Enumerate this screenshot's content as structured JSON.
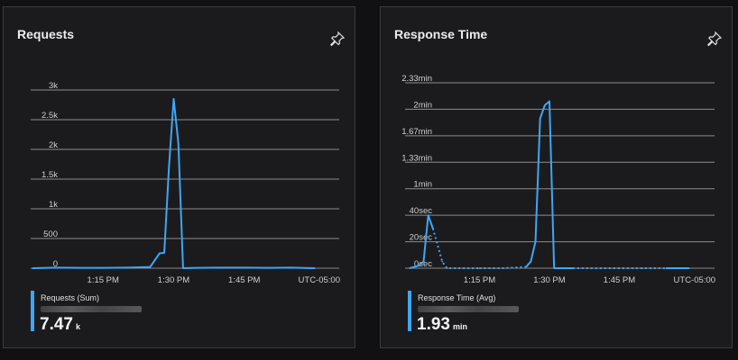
{
  "tiles": [
    {
      "title": "Requests",
      "pin_icon": "pin-icon",
      "y_ticks": [
        "0",
        "500",
        "1k",
        "1.5k",
        "2k",
        "2.5k",
        "3k"
      ],
      "x_ticks": [
        "1:15 PM",
        "1:30 PM",
        "1:45 PM"
      ],
      "timezone": "UTC-05:00",
      "legend": {
        "name": "Requests (Sum)",
        "value": "7.47",
        "unit": "k",
        "color": "#3ea6f5"
      }
    },
    {
      "title": "Response Time",
      "pin_icon": "pin-icon",
      "y_ticks": [
        "0sec",
        "20sec",
        "40sec",
        "1min",
        "1.33min",
        "1.67min",
        "2min",
        "2.33min"
      ],
      "x_ticks": [
        "1:15 PM",
        "1:30 PM",
        "1:45 PM"
      ],
      "timezone": "UTC-05:00",
      "legend": {
        "name": "Response Time (Avg)",
        "value": "1.93",
        "unit": "min",
        "color": "#3ea6f5"
      }
    }
  ],
  "chart_data": [
    {
      "type": "line",
      "title": "Requests",
      "ylabel": "",
      "ylim": [
        0,
        3000
      ],
      "series": [
        {
          "name": "Requests (Sum)",
          "points": [
            [
              "1:00 PM",
              0
            ],
            [
              "1:05 PM",
              10
            ],
            [
              "1:10 PM",
              5
            ],
            [
              "1:15 PM",
              5
            ],
            [
              "1:20 PM",
              10
            ],
            [
              "1:25 PM",
              20
            ],
            [
              "1:27 PM",
              250
            ],
            [
              "1:28 PM",
              260
            ],
            [
              "1:29 PM",
              1700
            ],
            [
              "1:30 PM",
              2850
            ],
            [
              "1:31 PM",
              2100
            ],
            [
              "1:32 PM",
              0
            ],
            [
              "1:35 PM",
              5
            ],
            [
              "1:40 PM",
              10
            ],
            [
              "1:45 PM",
              10
            ],
            [
              "1:50 PM",
              5
            ],
            [
              "1:55 PM",
              10
            ],
            [
              "2:00 PM",
              0
            ]
          ]
        }
      ]
    },
    {
      "type": "line",
      "title": "Response Time",
      "ylabel": "",
      "ylim": [
        0,
        140
      ],
      "series": [
        {
          "name": "Response Time (Avg)",
          "points": [
            [
              "1:00 PM",
              0
            ],
            [
              "1:02 PM",
              2
            ],
            [
              "1:03 PM",
              5
            ],
            [
              "1:04 PM",
              40
            ],
            [
              "1:05 PM",
              30
            ],
            [
              "1:07 PM",
              5
            ],
            [
              "1:08 PM",
              0
            ],
            [
              "1:15 PM",
              0
            ],
            [
              "1:20 PM",
              0
            ],
            [
              "1:25 PM",
              1
            ],
            [
              "1:26 PM",
              5
            ],
            [
              "1:27 PM",
              20
            ],
            [
              "1:28 PM",
              113
            ],
            [
              "1:29 PM",
              123
            ],
            [
              "1:30 PM",
              126
            ],
            [
              "1:31 PM",
              0
            ],
            [
              "1:35 PM",
              0
            ],
            [
              "1:40 PM",
              0
            ],
            [
              "1:45 PM",
              0
            ],
            [
              "1:50 PM",
              0
            ],
            [
              "1:55 PM",
              0
            ],
            [
              "2:00 PM",
              0
            ]
          ]
        }
      ]
    }
  ]
}
